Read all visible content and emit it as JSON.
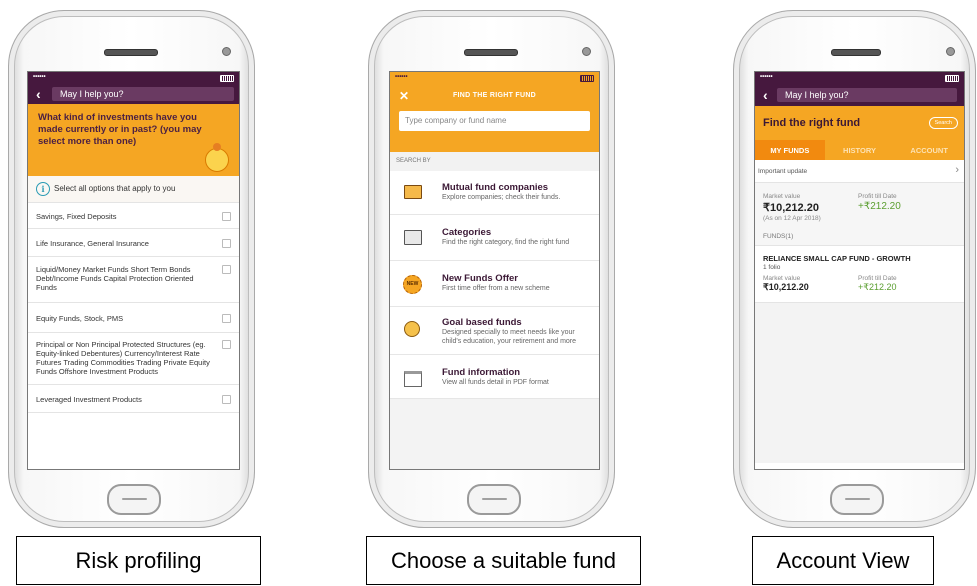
{
  "phones": {
    "risk": {
      "help_text": "May I help you?",
      "question": "What kind of investments have you made currently or in past? (you may select more than one)",
      "instruction": "Select all options that apply to you",
      "options": [
        "Savings, Fixed Deposits",
        "Life Insurance, General Insurance",
        "Liquid/Money Market Funds Short Term Bonds Debt/Income Funds Capital Protection Oriented Funds",
        "Equity Funds, Stock, PMS",
        "Principal or Non Principal Protected Structures (eg. Equity-linked Debentures) Currency/Interest Rate Futures Trading Commodities Trading Private Equity Funds Offshore Investment Products",
        "Leveraged Investment Products"
      ]
    },
    "fund": {
      "header_title": "FIND THE RIGHT FUND",
      "search_placeholder": "Type company or fund name",
      "section_label": "SEARCH BY",
      "items": [
        {
          "title": "Mutual fund companies",
          "subtitle": "Explore companies; check their funds."
        },
        {
          "title": "Categories",
          "subtitle": "Find the right category, find the right fund"
        },
        {
          "title": "New Funds Offer",
          "subtitle": "First time offer from a new scheme"
        },
        {
          "title": "Goal based funds",
          "subtitle": "Designed specially to meet needs like your child's education, your retirement and more"
        },
        {
          "title": "Fund information",
          "subtitle": "View all funds detail in PDF format"
        }
      ]
    },
    "account": {
      "help_text": "May I help you?",
      "title": "Find the right fund",
      "search_button": "Search",
      "tabs": [
        "MY FUNDS",
        "HISTORY",
        "ACCOUNT"
      ],
      "update_label": "Important update",
      "market_label": "Market value",
      "market_value": "₹10,212.20",
      "as_on": "(As on 12 Apr 2018)",
      "profit_label": "Profit till Date",
      "profit_value": "+₹212.20",
      "funds_label": "FUNDS(1)",
      "fund_name": "RELIANCE SMALL CAP FUND - GROWTH",
      "folio": "1 folio",
      "fund_market_label": "Market value",
      "fund_market_value": "₹10,212.20",
      "fund_profit_label": "Profit till Date",
      "fund_profit_value": "+₹212.20"
    }
  },
  "captions": {
    "risk": "Risk profiling",
    "fund": "Choose a suitable fund",
    "account": "Account View"
  },
  "colors": {
    "purple": "#46183e",
    "orange": "#f5a623",
    "green": "#5a9e2f"
  }
}
